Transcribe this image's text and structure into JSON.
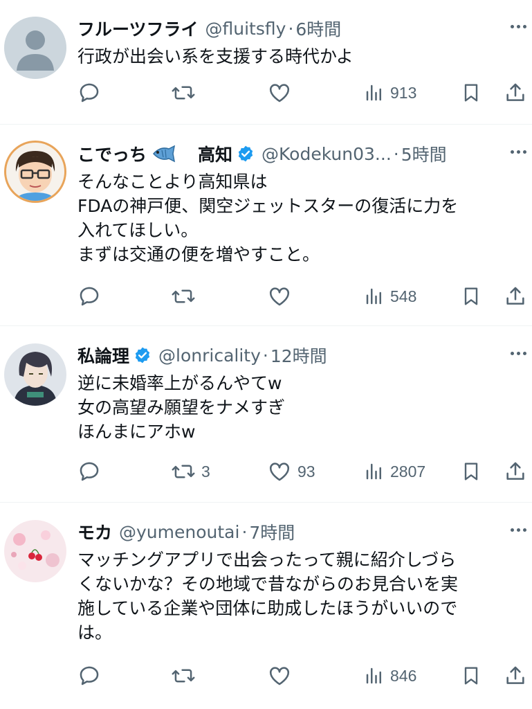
{
  "tweets": [
    {
      "name": "フルーツフライ",
      "emoji": "",
      "name2": "",
      "verified": false,
      "handle": "@fluitsfly",
      "dot": "·",
      "time": "6時間",
      "lines": [
        "行政が出会い系を支援する時代かよ"
      ],
      "replies": "",
      "retweets": "",
      "likes": "",
      "views": "913",
      "avatar": "default-avatar"
    },
    {
      "name": "こでっち",
      "emoji": "fish-emoji",
      "name2": "高知",
      "verified": true,
      "handle": "@Kodekun03...",
      "dot": "·",
      "time": "5時間",
      "lines": [
        "そんなことより高知県は",
        "FDAの神戸便、関空ジェットスターの復活に力を",
        "入れてほしい。",
        "まずは交通の便を増やすこと。"
      ],
      "replies": "",
      "retweets": "",
      "likes": "",
      "views": "548",
      "avatar": "glasses-man-avatar"
    },
    {
      "name": "私論理",
      "emoji": "",
      "name2": "",
      "verified": true,
      "handle": "@lonricality",
      "dot": "·",
      "time": "12時間",
      "lines": [
        "逆に未婚率上がるんやてw",
        "女の高望み願望をナメすぎ",
        "ほんまにアホw"
      ],
      "replies": "",
      "retweets": "3",
      "likes": "93",
      "views": "2807",
      "avatar": "anime-character-avatar"
    },
    {
      "name": "モカ",
      "emoji": "",
      "name2": "",
      "verified": false,
      "handle": "@yumenoutai",
      "dot": "·",
      "time": "7時間",
      "lines": [
        "マッチングアプリで出会ったって親に紹介しづら",
        "くないかな？その地域で昔ながらのお見合いを実",
        "施している企業や団体に助成したほうがいいので",
        "は。"
      ],
      "replies": "",
      "retweets": "",
      "likes": "",
      "views": "846",
      "avatar": "flowers-avatar"
    }
  ],
  "colors": {
    "text": "#0f1419",
    "secondary": "#536471",
    "verified": "#1d9bf0",
    "divider": "#eff3f4"
  }
}
